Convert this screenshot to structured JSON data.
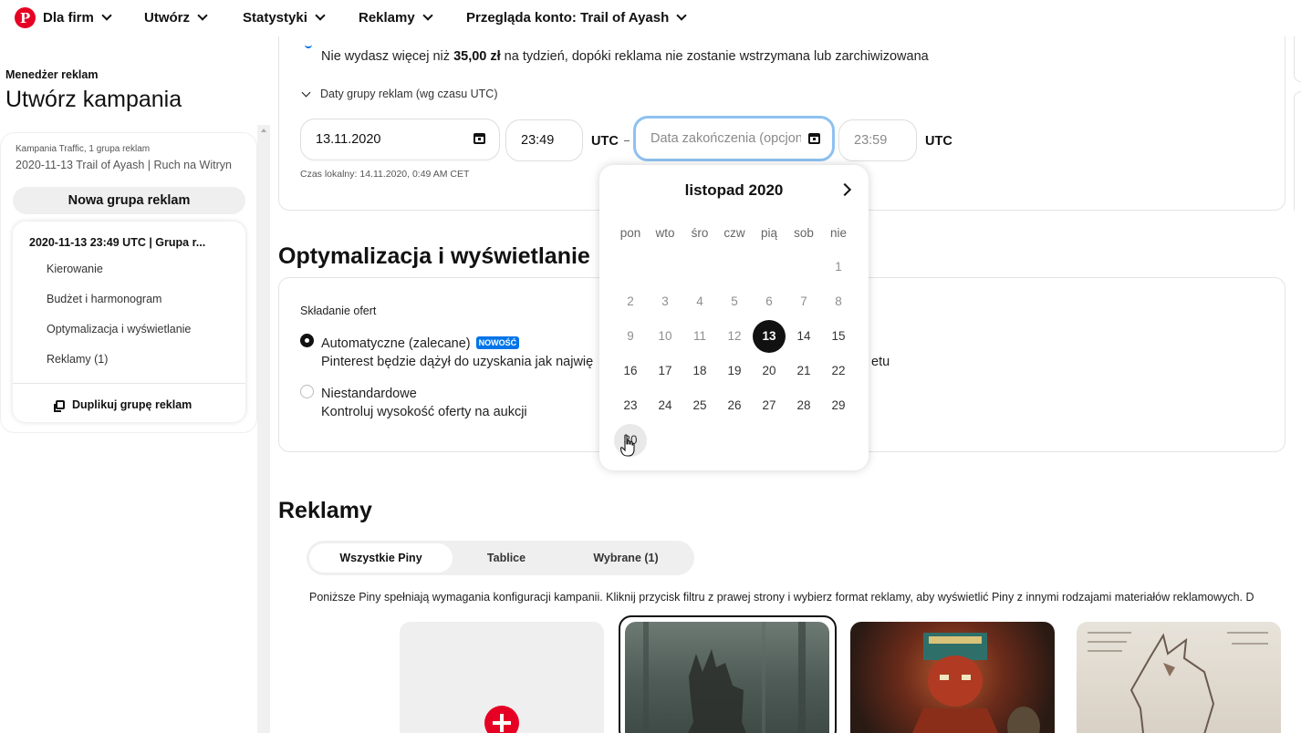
{
  "nav": {
    "brand": "Dla firm",
    "items": [
      "Utwórz",
      "Statystyki",
      "Reklamy"
    ],
    "account": "Przegląda konto: Trail of Ayash"
  },
  "sidebar": {
    "breadcrumb": "Menedżer reklam",
    "title": "Utwórz kampania",
    "campaign_meta": "Kampania Traffic, 1 grupa reklam",
    "campaign_name": "2020-11-13 Trail of Ayash | Ruch na Witryn",
    "new_group_button": "Nowa grupa reklam",
    "group_title": "2020-11-13 23:49 UTC | Grupa r...",
    "group_links": [
      "Kierowanie",
      "Budżet i harmonogram",
      "Optymalizacja i wyświetlanie",
      "Reklamy (1)"
    ],
    "duplicate_button": "Duplikuj grupę reklam"
  },
  "budget": {
    "spend_prefix": "Nie wydasz więcej niż ",
    "spend_amount": "35,00 zł",
    "spend_suffix": " na tydzień, dopóki reklama nie zostanie wstrzymana lub zarchiwizowana",
    "dates_toggle": "Daty grupy reklam (wg czasu UTC)",
    "start_date": "13.11.2020",
    "start_time": "23:49",
    "tz1": "UTC",
    "end_date_placeholder": "Data zakończenia (opcjonalnie)",
    "end_time_placeholder": "23:59",
    "tz2": "UTC",
    "local_time": "Czas lokalny: 14.11.2020, 0:49 AM CET"
  },
  "optimization": {
    "heading": "Optymalizacja i wyświetlanie",
    "bid_label": "Składanie ofert",
    "auto_title": "Automatyczne (zalecane)",
    "auto_badge": "NOWOŚĆ",
    "auto_desc": "Pinterest będzie dążył do uzyskania jak najwię",
    "auto_desc_end": "etu",
    "custom_title": "Niestandardowe",
    "custom_desc": "Kontroluj wysokość oferty na aukcji"
  },
  "datepicker": {
    "month": "listopad 2020",
    "weekdays": [
      "pon",
      "wto",
      "śro",
      "czw",
      "pią",
      "sob",
      "nie"
    ],
    "selected_day": "13",
    "hover_day": "30"
  },
  "ads": {
    "heading": "Reklamy",
    "tabs": [
      "Wszystkie Piny",
      "Tablice",
      "Wybrane (1)"
    ],
    "note": "Poniższe Piny spełniają wymagania konfiguracji kampanii. Kliknij przycisk filtru z prawej strony i wybierz format reklamy, aby wyświetlić Piny z innymi rodzajami materiałów reklamowych. D"
  },
  "colors": {
    "brand_red": "#e60023",
    "focus_blue": "#0074e8"
  }
}
